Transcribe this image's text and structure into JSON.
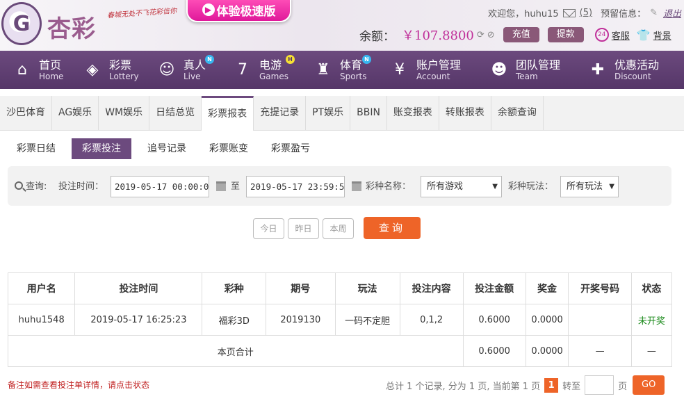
{
  "header": {
    "logo_text": "杏彩",
    "slogan": "春城无处不飞花彩信你",
    "promo_label": "体验极速版",
    "welcome": "欢迎您，",
    "username": "huhu15",
    "mail_count": "(5)",
    "reserved_info": "预留信息：",
    "logout": "退出",
    "balance_label": "余额：",
    "balance_value": "￥107.8800",
    "deposit": "充值",
    "withdraw": "提款",
    "service": "客服",
    "background": "背景"
  },
  "nav": [
    {
      "cn": "首页",
      "en": "Home",
      "icon": "home-icon",
      "glyph": "⌂",
      "badge": ""
    },
    {
      "cn": "彩票",
      "en": "Lottery",
      "icon": "ticket-icon",
      "glyph": "◈",
      "badge": ""
    },
    {
      "cn": "真人",
      "en": "Live",
      "icon": "person-icon",
      "glyph": "☺",
      "badge": "N"
    },
    {
      "cn": "电游",
      "en": "Games",
      "icon": "slot-seven-icon",
      "glyph": "7",
      "badge": "H"
    },
    {
      "cn": "体育",
      "en": "Sports",
      "icon": "trophy-icon",
      "glyph": "♜",
      "badge": "N"
    },
    {
      "cn": "账户管理",
      "en": "Account",
      "icon": "yen-coin-icon",
      "glyph": "¥",
      "badge": ""
    },
    {
      "cn": "团队管理",
      "en": "Team",
      "icon": "team-icon",
      "glyph": "☻",
      "badge": ""
    },
    {
      "cn": "优惠活动",
      "en": "Discount",
      "icon": "gift-icon",
      "glyph": "✚",
      "badge": ""
    }
  ],
  "tabs": [
    "沙巴体育",
    "AG娱乐",
    "WM娱乐",
    "日结总览",
    "彩票报表",
    "充提记录",
    "PT娱乐",
    "BBIN",
    "账变报表",
    "转账报表",
    "余额查询"
  ],
  "subtabs": [
    "彩票日结",
    "彩票投注",
    "追号记录",
    "彩票账变",
    "彩票盈亏"
  ],
  "query": {
    "label": "查询:",
    "time_label": "投注时间：",
    "start": "2019-05-17 00:00:00",
    "to": "至",
    "end": "2019-05-17 23:59:59",
    "game_label": "彩种名称：",
    "game_value": "所有游戏",
    "method_label": "彩种玩法：",
    "method_value": "所有玩法",
    "today": "今日",
    "yesterday": "昨日",
    "week": "本周",
    "submit": "查询"
  },
  "table": {
    "headers": [
      "用户名",
      "投注时间",
      "彩种",
      "期号",
      "玩法",
      "投注内容",
      "投注金额",
      "奖金",
      "开奖号码",
      "状态"
    ],
    "rows": [
      {
        "user": "huhu1548",
        "time": "2019-05-17 16:25:23",
        "game": "福彩3D",
        "issue": "2019130",
        "method": "一码不定胆",
        "content": "0,1,2",
        "amount": "0.6000",
        "bonus": "0.0000",
        "draw": "",
        "status": "未开奖"
      }
    ],
    "subtotal": {
      "label": "本页合计",
      "amount": "0.6000",
      "bonus": "0.0000",
      "draw": "—",
      "status": "—"
    }
  },
  "note": "备注如需查看投注单详情，请点击状态",
  "pager": {
    "summary": "总计 1 个记录, 分为 1 页, 当前第 1 页",
    "current": "1",
    "goto": "转至",
    "page_unit": "页",
    "go": "GO"
  },
  "colors": {
    "brand_purple": "#6c4a7e",
    "accent_orange": "#ee6428",
    "balance_pink": "#c0309a",
    "status_green": "#1a8a1a"
  }
}
